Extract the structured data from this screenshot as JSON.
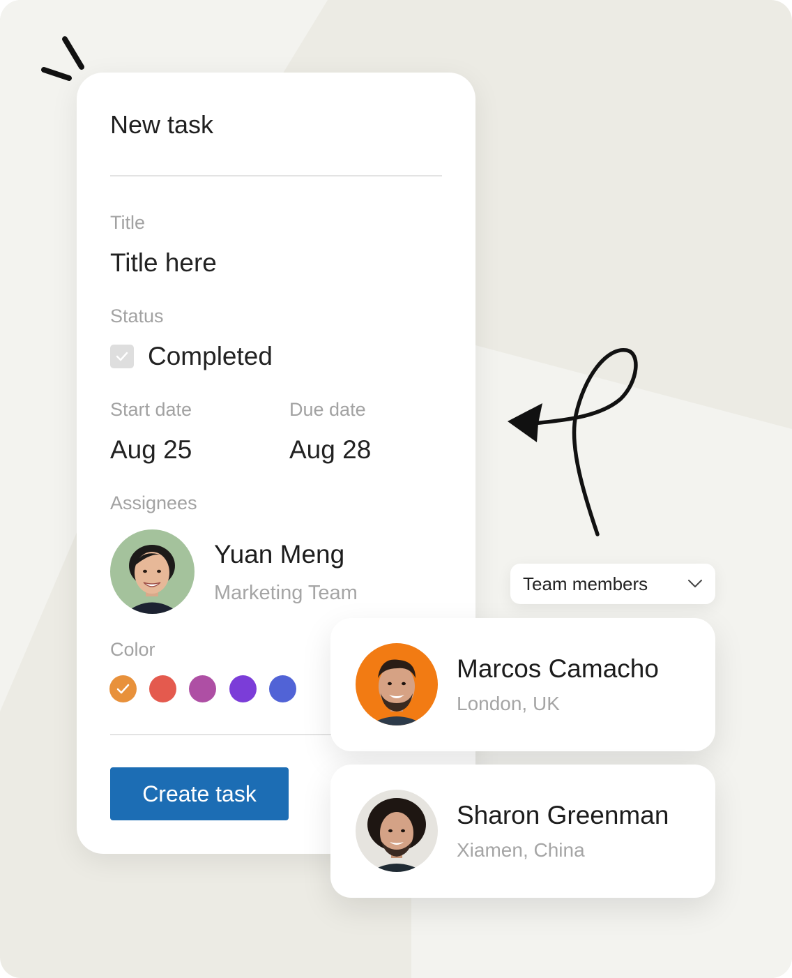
{
  "task_form": {
    "heading": "New task",
    "title": {
      "label": "Title",
      "value": "Title here"
    },
    "status": {
      "label": "Status",
      "value": "Completed",
      "checked": true
    },
    "start_date": {
      "label": "Start date",
      "value": "Aug 25"
    },
    "due_date": {
      "label": "Due date",
      "value": "Aug 28"
    },
    "assignees": {
      "label": "Assignees",
      "items": [
        {
          "name": "Yuan Meng",
          "team": "Marketing Team"
        }
      ]
    },
    "color": {
      "label": "Color",
      "options": [
        "#E8913B",
        "#E45A4E",
        "#AE4FA4",
        "#7B3DD8",
        "#5163D6"
      ],
      "selected": "#E8913B"
    },
    "create_button": "Create task"
  },
  "members_panel": {
    "dropdown_label": "Team members",
    "members": [
      {
        "name": "Marcos Camacho",
        "location": "London, UK"
      },
      {
        "name": "Sharon Greenman",
        "location": "Xiamen, China"
      }
    ]
  },
  "colors": {
    "primary": "#1C6DB4",
    "background": "#ECEBE4",
    "card": "#FFFFFF"
  }
}
